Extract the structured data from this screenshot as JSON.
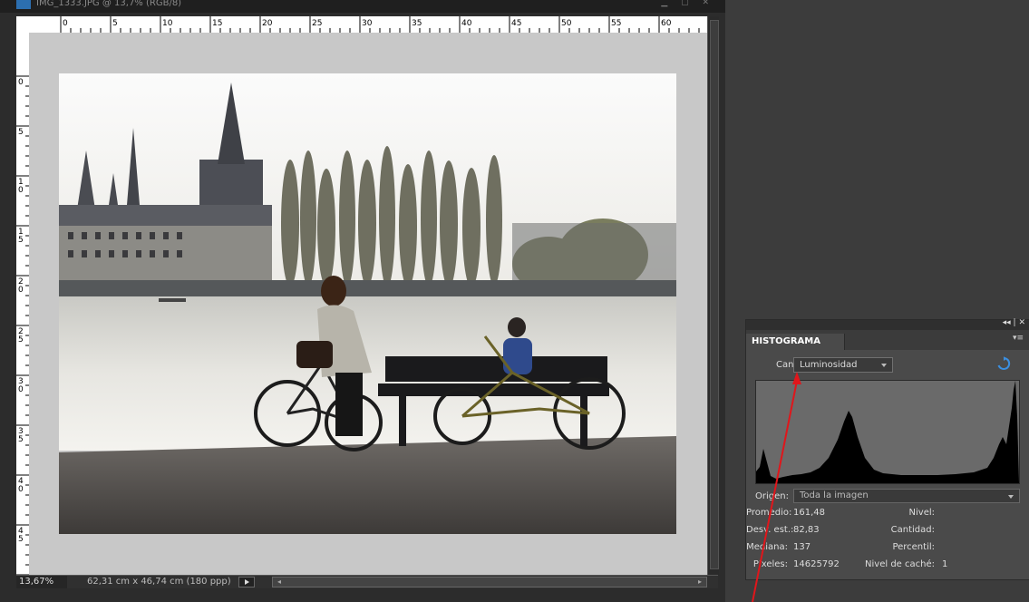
{
  "document": {
    "title": "IMG_1333.JPG @ 13,7% (RGB/8)",
    "zoom": "13,67%",
    "size": "62,31 cm x 46,74 cm (180 ppp)",
    "hruler_labels": [
      "0",
      "5",
      "10",
      "15",
      "20",
      "25",
      "30",
      "35",
      "40",
      "45",
      "50",
      "55",
      "60"
    ],
    "vruler_labels": [
      "0",
      "5",
      "1 0",
      "1 5",
      "2 0",
      "2 5",
      "3 0",
      "3 5",
      "4 0",
      "4 5",
      "5"
    ]
  },
  "histogram": {
    "tab_label": "HISTOGRAMA",
    "panel_icons": "◂◂ | ✕",
    "canal_label": "Canal:",
    "canal_value": "Luminosidad",
    "origen_label": "Origen:",
    "origen_value": "Toda la imagen",
    "stats": {
      "promedio_label": "Promedio:",
      "promedio": "161,48",
      "desv_label": "Desv. est.:",
      "desv": "82,83",
      "mediana_label": "Mediana:",
      "mediana": "137",
      "pixeles_label": "Píxeles:",
      "pixeles": "14625792",
      "nivel_label": "Nivel:",
      "cantidad_label": "Cantidad:",
      "percentil_label": "Percentil:",
      "cache_label": "Nivel de caché:",
      "cache": "1"
    }
  },
  "colors": {
    "accent_arrow": "#e0161b",
    "refresh_icon": "#3b8fe0",
    "panel_bg": "#4a4a4a"
  }
}
